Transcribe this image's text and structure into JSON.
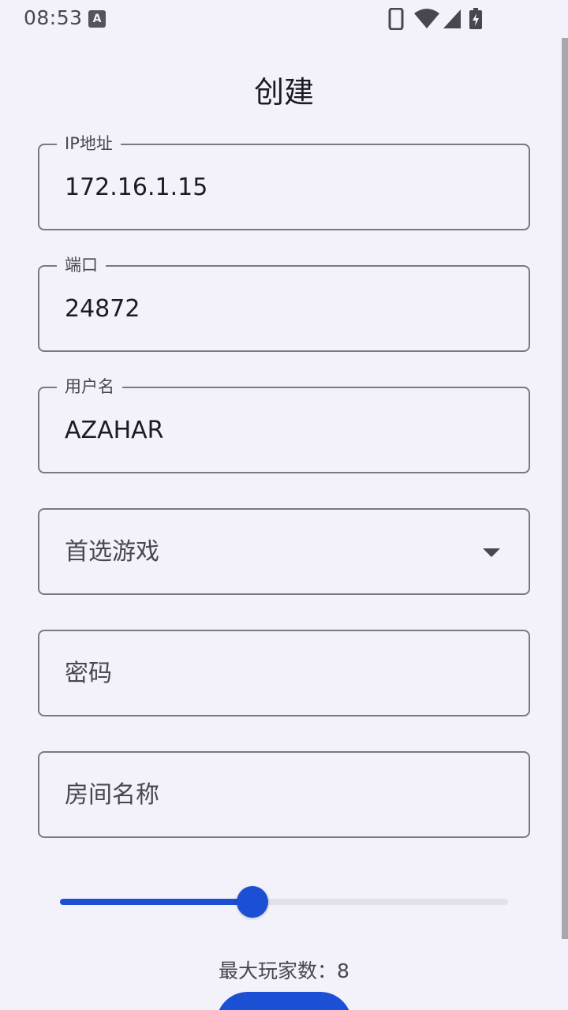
{
  "status_bar": {
    "time": "08:53",
    "app_icon_letter": "A",
    "icons": [
      "phone-icon",
      "wifi-icon",
      "signal-icon",
      "battery-charging-icon"
    ]
  },
  "page": {
    "title": "创建"
  },
  "fields": {
    "ip": {
      "label": "IP地址",
      "value": "172.16.1.15"
    },
    "port": {
      "label": "端口",
      "value": "24872"
    },
    "username": {
      "label": "用户名",
      "value": "AZAHAR"
    },
    "preferred_game": {
      "placeholder": "首选游戏"
    },
    "password": {
      "placeholder": "密码"
    },
    "room_name": {
      "placeholder": "房间名称"
    }
  },
  "slider": {
    "fraction": 0.43
  },
  "max_players": {
    "text": "最大玩家数：8"
  },
  "colors": {
    "accent": "#1b4fd4",
    "background": "#f3f2fa",
    "outline": "#7a7883",
    "track_inactive": "#e1e0eb"
  }
}
